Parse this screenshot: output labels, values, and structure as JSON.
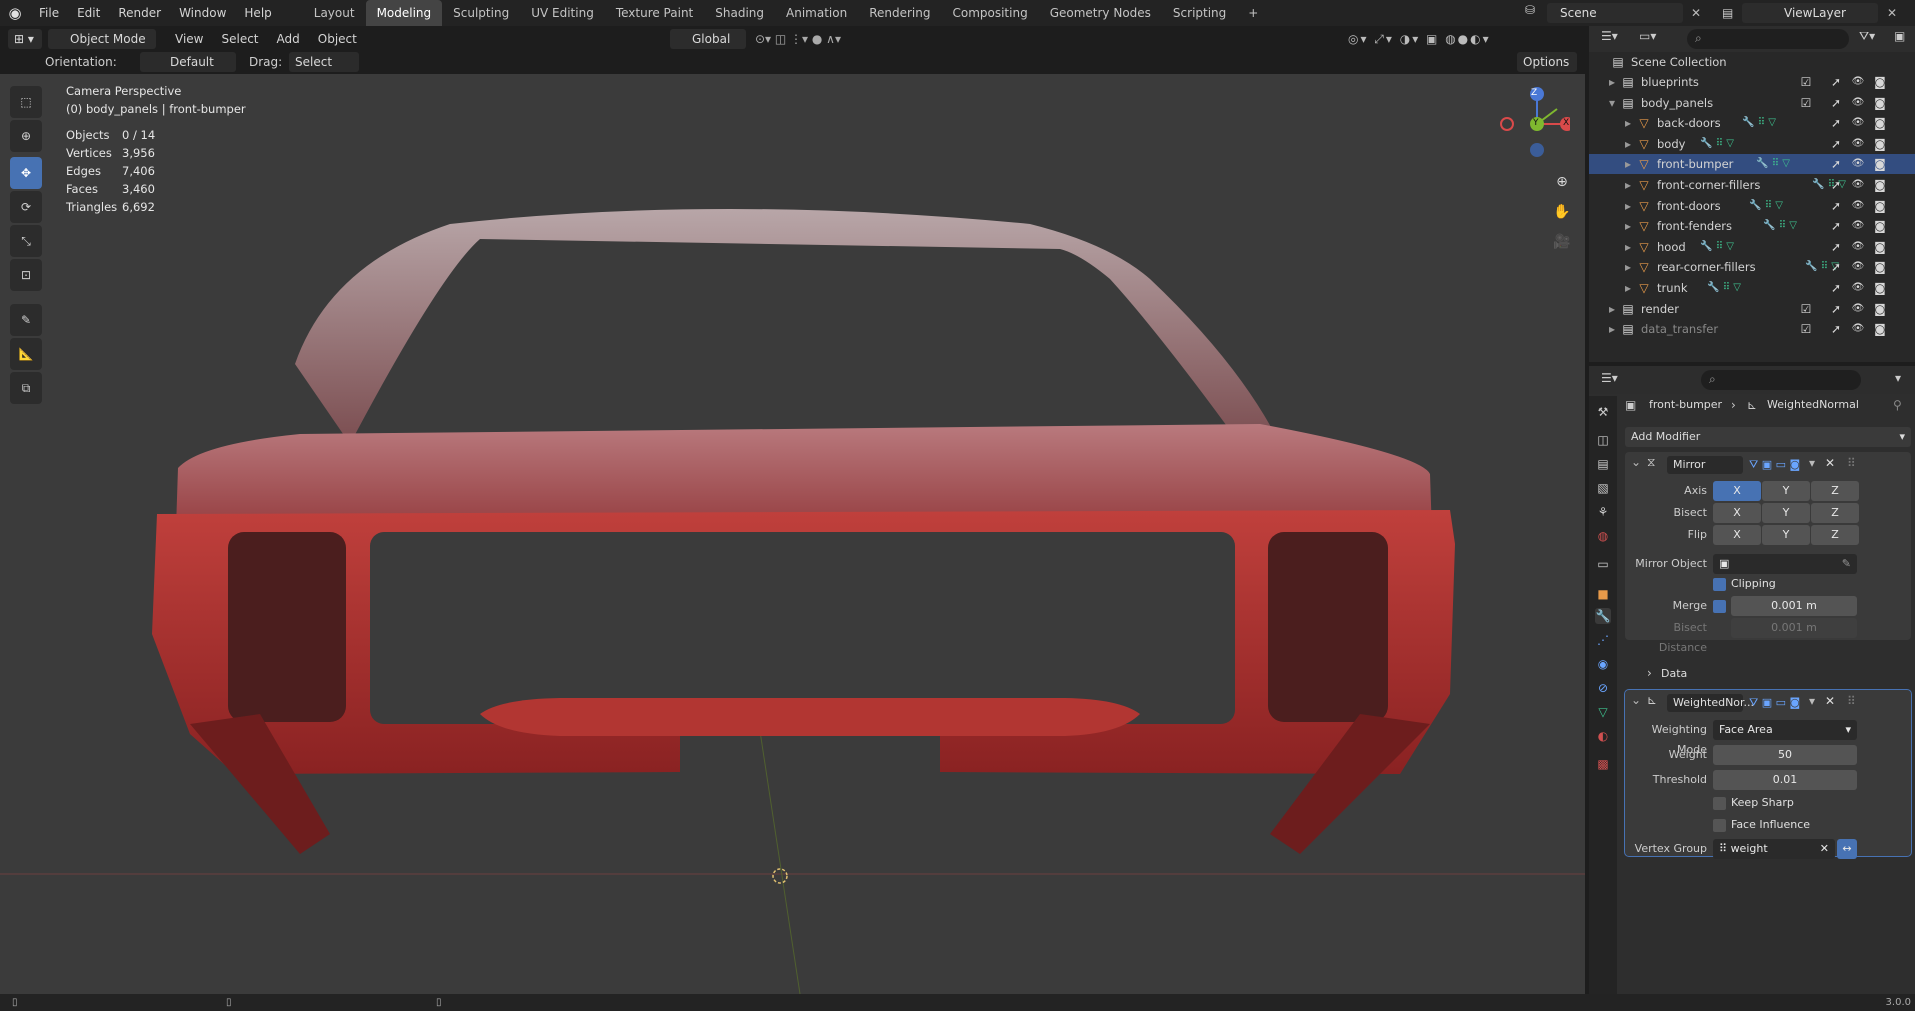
{
  "menu": [
    "File",
    "Edit",
    "Render",
    "Window",
    "Help"
  ],
  "workspaces": [
    "Layout",
    "Modeling",
    "Sculpting",
    "UV Editing",
    "Texture Paint",
    "Shading",
    "Animation",
    "Rendering",
    "Compositing",
    "Geometry Nodes",
    "Scripting"
  ],
  "active_workspace": "Modeling",
  "add_workspace": "+",
  "scene": {
    "name": "Scene",
    "view_layer": "ViewLayer"
  },
  "header": {
    "mode": "Object Mode",
    "menus": [
      "View",
      "Select",
      "Add",
      "Object"
    ],
    "transform": "Global",
    "orientation_label": "Orientation:",
    "orientation_value": "Default",
    "drag_label": "Drag:",
    "drag_value": "Select Box",
    "options": "Options"
  },
  "overlay": {
    "view_name": "Camera Perspective",
    "context": "(0) body_panels | front-bumper",
    "stats": [
      {
        "label": "Objects",
        "value": "0 / 14"
      },
      {
        "label": "Vertices",
        "value": "3,956"
      },
      {
        "label": "Edges",
        "value": "7,406"
      },
      {
        "label": "Faces",
        "value": "3,460"
      },
      {
        "label": "Triangles",
        "value": "6,692"
      }
    ]
  },
  "gizmo": {
    "z": "Z",
    "y": "Y",
    "x": "X"
  },
  "outliner": {
    "root": "Scene Collection",
    "items": [
      {
        "name": "blueprints",
        "level": 0,
        "type": "collection"
      },
      {
        "name": "body_panels",
        "level": 0,
        "type": "collection",
        "expanded": true
      },
      {
        "name": "back-doors",
        "level": 1,
        "type": "object"
      },
      {
        "name": "body",
        "level": 1,
        "type": "object"
      },
      {
        "name": "front-bumper",
        "level": 1,
        "type": "object",
        "active": true
      },
      {
        "name": "front-corner-fillers",
        "level": 1,
        "type": "object"
      },
      {
        "name": "front-doors",
        "level": 1,
        "type": "object"
      },
      {
        "name": "front-fenders",
        "level": 1,
        "type": "object"
      },
      {
        "name": "hood",
        "level": 1,
        "type": "object"
      },
      {
        "name": "rear-corner-fillers",
        "level": 1,
        "type": "object"
      },
      {
        "name": "trunk",
        "level": 1,
        "type": "object"
      },
      {
        "name": "render",
        "level": 0,
        "type": "collection"
      },
      {
        "name": "data_transfer",
        "level": 0,
        "type": "collection",
        "dim": true
      }
    ]
  },
  "properties": {
    "breadcrumb_object": "front-bumper",
    "breadcrumb_modifier": "WeightedNormal",
    "add_modifier": "Add Modifier",
    "mirror": {
      "name": "Mirror",
      "axis_label": "Axis",
      "bisect_label": "Bisect",
      "flip_label": "Flip",
      "xyz": [
        "X",
        "Y",
        "Z"
      ],
      "mirror_object_label": "Mirror Object",
      "clipping_label": "Clipping",
      "merge_label": "Merge",
      "merge_value": "0.001 m",
      "bisect_distance_label": "Bisect Distance",
      "bisect_distance_value": "0.001 m",
      "data_label": "Data"
    },
    "weighted": {
      "name": "WeightedNor...",
      "mode_label": "Weighting Mode",
      "mode_value": "Face Area",
      "weight_label": "Weight",
      "weight_value": "50",
      "threshold_label": "Threshold",
      "threshold_value": "0.01",
      "keep_sharp_label": "Keep Sharp",
      "face_influence_label": "Face Influence",
      "vertex_group_label": "Vertex Group",
      "vertex_group_value": "weight"
    }
  },
  "version": "3.0.0",
  "colors": {
    "accent": "#4772b3",
    "car_red": "#a52a2a",
    "orange_obj": "#e79a4a",
    "mesh_green": "#3ec28f"
  }
}
